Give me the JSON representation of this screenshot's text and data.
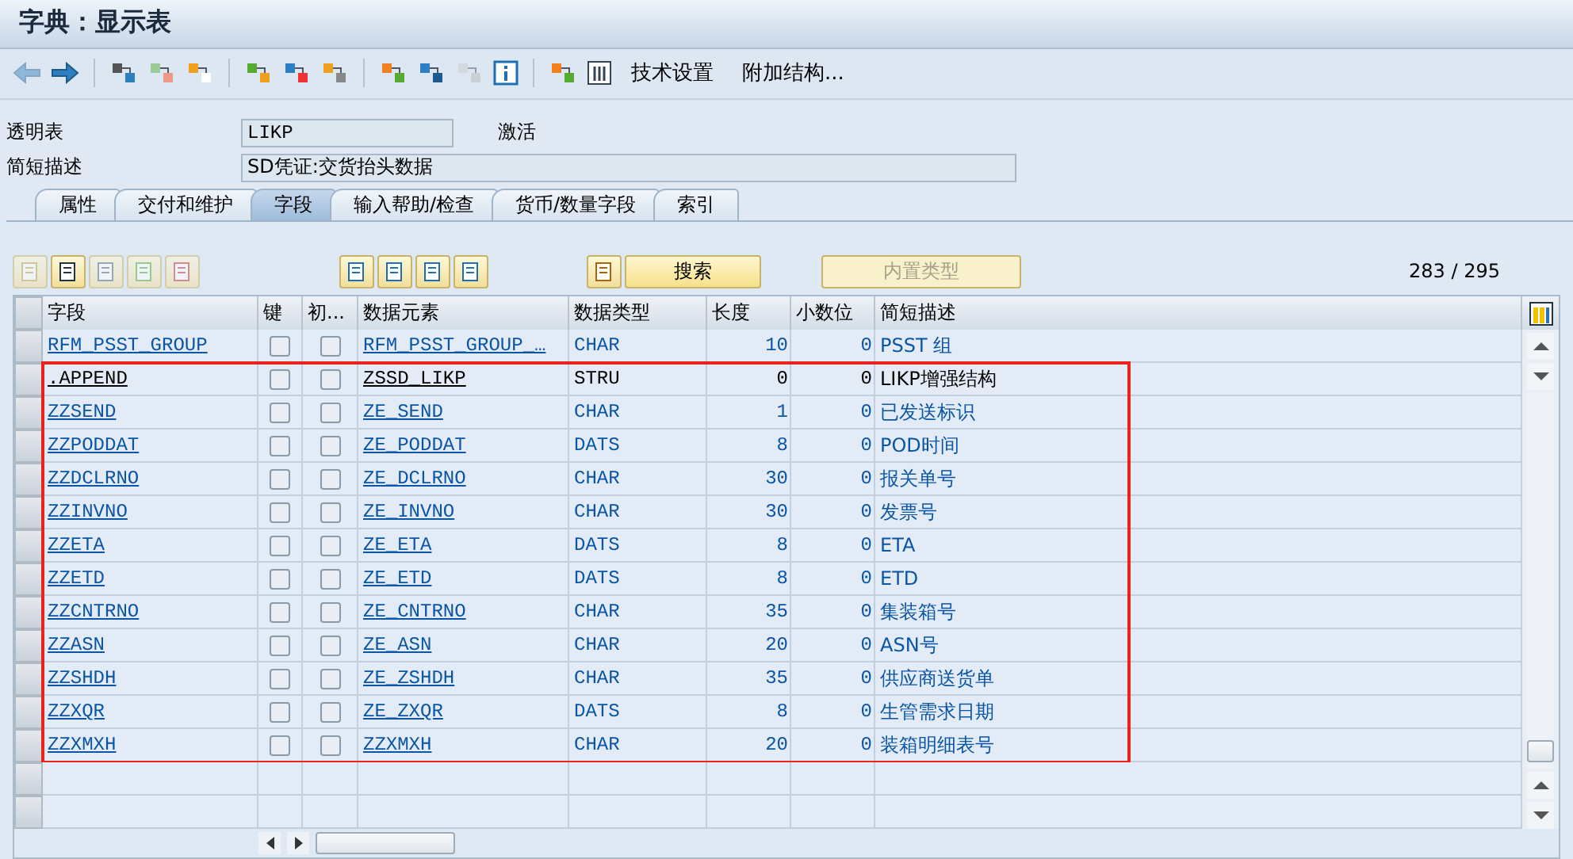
{
  "window": {
    "title": "字典：显示表"
  },
  "toolbar": {
    "buttons": [
      {
        "label": "技术设置"
      },
      {
        "label": "附加结构..."
      }
    ]
  },
  "header": {
    "table_label": "透明表",
    "table_value": "LIKP",
    "status": "激活",
    "desc_label": "简短描述",
    "desc_value": "SD凭证:交货抬头数据"
  },
  "tabs": [
    {
      "label": "属性",
      "selected": false
    },
    {
      "label": "交付和维护",
      "selected": false
    },
    {
      "label": "字段",
      "selected": true
    },
    {
      "label": "输入帮助/检查",
      "selected": false
    },
    {
      "label": "货币/数量字段",
      "selected": false
    },
    {
      "label": "索引",
      "selected": false
    }
  ],
  "table_toolbar": {
    "search": "搜索",
    "builtin": "内置类型",
    "builtin_disabled": true,
    "counter": "283 / 295"
  },
  "table": {
    "columns": [
      "字段",
      "键",
      "初...",
      "数据元素",
      "数据类型",
      "长度",
      "小数位",
      "简短描述"
    ],
    "rows": [
      {
        "kind": "field",
        "highlighted": false,
        "field": "RFM_PSST_GROUP",
        "key": false,
        "initial": false,
        "element": "RFM_PSST_GROUP_…",
        "type": "CHAR",
        "length": "10",
        "decimals": "0",
        "description": "PSST 组"
      },
      {
        "kind": "include",
        "highlighted": true,
        "field": ".APPEND",
        "key": false,
        "initial": false,
        "element": "ZSSD_LIKP",
        "type": "STRU",
        "length": "0",
        "decimals": "0",
        "description": "LIKP增强结构"
      },
      {
        "kind": "field",
        "highlighted": true,
        "field": "ZZSEND",
        "key": false,
        "initial": false,
        "element": "ZE_SEND",
        "type": "CHAR",
        "length": "1",
        "decimals": "0",
        "description": "已发送标识"
      },
      {
        "kind": "field",
        "highlighted": true,
        "field": "ZZPODDAT",
        "key": false,
        "initial": false,
        "element": "ZE_PODDAT",
        "type": "DATS",
        "length": "8",
        "decimals": "0",
        "description": "POD时间"
      },
      {
        "kind": "field",
        "highlighted": true,
        "field": "ZZDCLRNO",
        "key": false,
        "initial": false,
        "element": "ZE_DCLRNO",
        "type": "CHAR",
        "length": "30",
        "decimals": "0",
        "description": "报关单号"
      },
      {
        "kind": "field",
        "highlighted": true,
        "field": "ZZINVNO",
        "key": false,
        "initial": false,
        "element": "ZE_INVNO",
        "type": "CHAR",
        "length": "30",
        "decimals": "0",
        "description": "发票号"
      },
      {
        "kind": "field",
        "highlighted": true,
        "field": "ZZETA",
        "key": false,
        "initial": false,
        "element": "ZE_ETA",
        "type": "DATS",
        "length": "8",
        "decimals": "0",
        "description": "ETA"
      },
      {
        "kind": "field",
        "highlighted": true,
        "field": "ZZETD",
        "key": false,
        "initial": false,
        "element": "ZE_ETD",
        "type": "DATS",
        "length": "8",
        "decimals": "0",
        "description": "ETD"
      },
      {
        "kind": "field",
        "highlighted": true,
        "field": "ZZCNTRNO",
        "key": false,
        "initial": false,
        "element": "ZE_CNTRNO",
        "type": "CHAR",
        "length": "35",
        "decimals": "0",
        "description": "集装箱号"
      },
      {
        "kind": "field",
        "highlighted": true,
        "field": "ZZASN",
        "key": false,
        "initial": false,
        "element": "ZE_ASN",
        "type": "CHAR",
        "length": "20",
        "decimals": "0",
        "description": "ASN号"
      },
      {
        "kind": "field",
        "highlighted": true,
        "field": "ZZSHDH",
        "key": false,
        "initial": false,
        "element": "ZE_ZSHDH",
        "type": "CHAR",
        "length": "35",
        "decimals": "0",
        "description": "供应商送货单"
      },
      {
        "kind": "field",
        "highlighted": true,
        "field": "ZZXQR",
        "key": false,
        "initial": false,
        "element": "ZE_ZXQR",
        "type": "DATS",
        "length": "8",
        "decimals": "0",
        "description": "生管需求日期"
      },
      {
        "kind": "field",
        "highlighted": true,
        "field": "ZZXMXH",
        "key": false,
        "initial": false,
        "element": "ZZXMXH",
        "type": "CHAR",
        "length": "20",
        "decimals": "0",
        "description": "装箱明细表号"
      }
    ]
  }
}
